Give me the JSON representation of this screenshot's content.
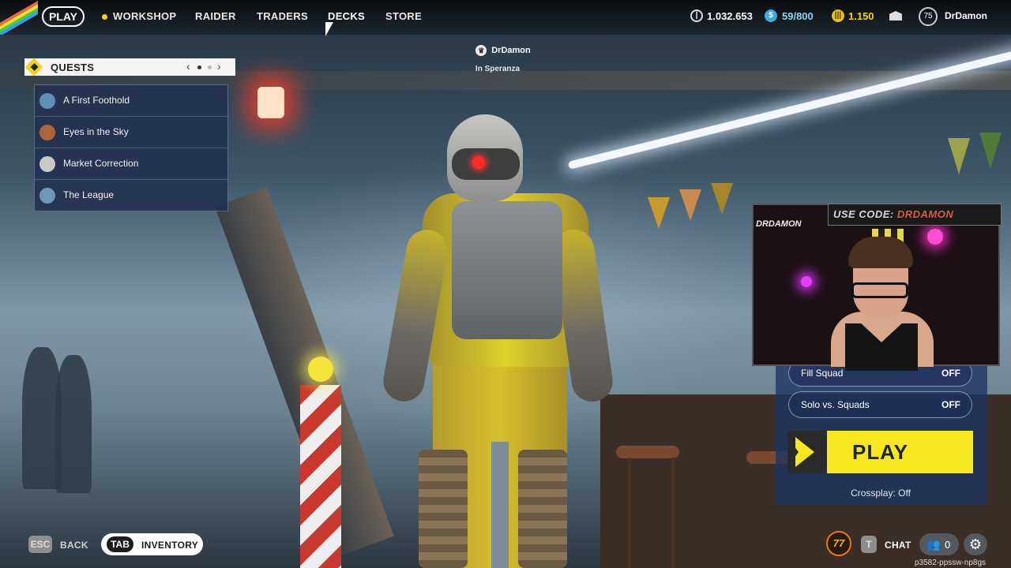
{
  "nav": {
    "play": "PLAY",
    "items": [
      "WORKSHOP",
      "RAIDER",
      "TRADERS",
      "DECKS",
      "STORE"
    ],
    "currencies": [
      {
        "icon": "coin-icon",
        "value": "1.032.653"
      },
      {
        "icon": "token-icon",
        "value": "59/800"
      },
      {
        "icon": "raider-points-icon",
        "value": "1.150"
      }
    ],
    "level": "75",
    "username": "DrDamon"
  },
  "player": {
    "name": "DrDamon",
    "location": "In Speranza"
  },
  "quests": {
    "title": "QUESTS",
    "items": [
      {
        "label": "A First Foothold",
        "avatar_color": "#5f8fb0"
      },
      {
        "label": "Eyes in the Sky",
        "avatar_color": "#b0643a"
      },
      {
        "label": "Market Correction",
        "avatar_color": "#c9c9c9"
      },
      {
        "label": "The League",
        "avatar_color": "#6f98b8"
      }
    ]
  },
  "stream_overlay": {
    "promo_prefix": "USE CODE:",
    "promo_code": "DRDAMON",
    "logo": "DRDAMON"
  },
  "matchmaking": {
    "options": [
      {
        "label": "Fill Squad",
        "value": "OFF"
      },
      {
        "label": "Solo vs. Squads",
        "value": "OFF"
      }
    ],
    "play_button": "PLAY",
    "crossplay": "Crossplay: Off"
  },
  "bottom": {
    "esc_key": "ESC",
    "back": "BACK",
    "tab_key": "TAB",
    "inventory": "INVENTORY",
    "badge": "77",
    "chat_key": "T",
    "chat": "CHAT",
    "friends_count": "0",
    "session_id": "p3582-ppssw-np8gs"
  },
  "colors": {
    "accent_yellow": "#f6e71e",
    "panel_blue": "#1e3464",
    "quest_bg": "#223150"
  }
}
